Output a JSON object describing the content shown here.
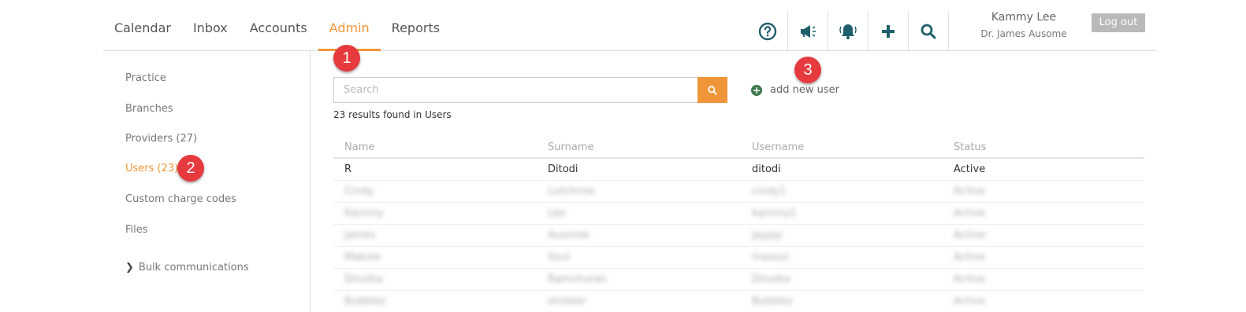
{
  "nav": {
    "tabs": [
      {
        "label": "Calendar"
      },
      {
        "label": "Inbox"
      },
      {
        "label": "Accounts"
      },
      {
        "label": "Admin",
        "active": true
      },
      {
        "label": "Reports"
      }
    ],
    "icons": [
      "help-icon",
      "megaphone-icon",
      "bell-icon",
      "plus-icon",
      "search-icon"
    ],
    "user_name": "Kammy Lee",
    "provider_name": "Dr. James Ausome",
    "logout_label": "Log out"
  },
  "sidebar": {
    "items": [
      {
        "label": "Practice"
      },
      {
        "label": "Branches"
      },
      {
        "label": "Providers (27)"
      },
      {
        "label": "Users (23)",
        "active": true
      },
      {
        "label": "Custom charge codes"
      },
      {
        "label": "Files"
      },
      {
        "label": "Bulk communications",
        "icon": "chevron-right-icon"
      }
    ]
  },
  "badges": [
    "1",
    "2",
    "3"
  ],
  "search": {
    "placeholder": "Search",
    "add_user_label": "add new user",
    "results_text": "23 results found in Users"
  },
  "table": {
    "columns": [
      "Name",
      "Surname",
      "Username",
      "Status"
    ],
    "rows": [
      {
        "name": "R",
        "surname": "Ditodi",
        "username": "ditodi",
        "status": "Active",
        "blurred": false
      },
      {
        "name": "Cindy",
        "surname": "Lutchmie",
        "username": "cindy1",
        "status": "Active",
        "blurred": true
      },
      {
        "name": "Kammy",
        "surname": "Lee",
        "username": "kammy1",
        "status": "Active",
        "blurred": true
      },
      {
        "name": "James",
        "surname": "Ausome",
        "username": "Jayjay",
        "status": "Active",
        "blurred": true
      },
      {
        "name": "Makole",
        "surname": "Soul",
        "username": "masoul",
        "status": "Active",
        "blurred": true
      },
      {
        "name": "Dinolka",
        "surname": "Ramchuran",
        "username": "Dinolka",
        "status": "Active",
        "blurred": true
      },
      {
        "name": "Bubblez",
        "surname": "ohsteer",
        "username": "Bubblez",
        "status": "Active",
        "blurred": true
      }
    ]
  },
  "colors": {
    "accent": "#f0963a",
    "icon": "#1f5f6b",
    "badge": "#e63a3e",
    "add_user_icon": "#3d7a4c"
  }
}
